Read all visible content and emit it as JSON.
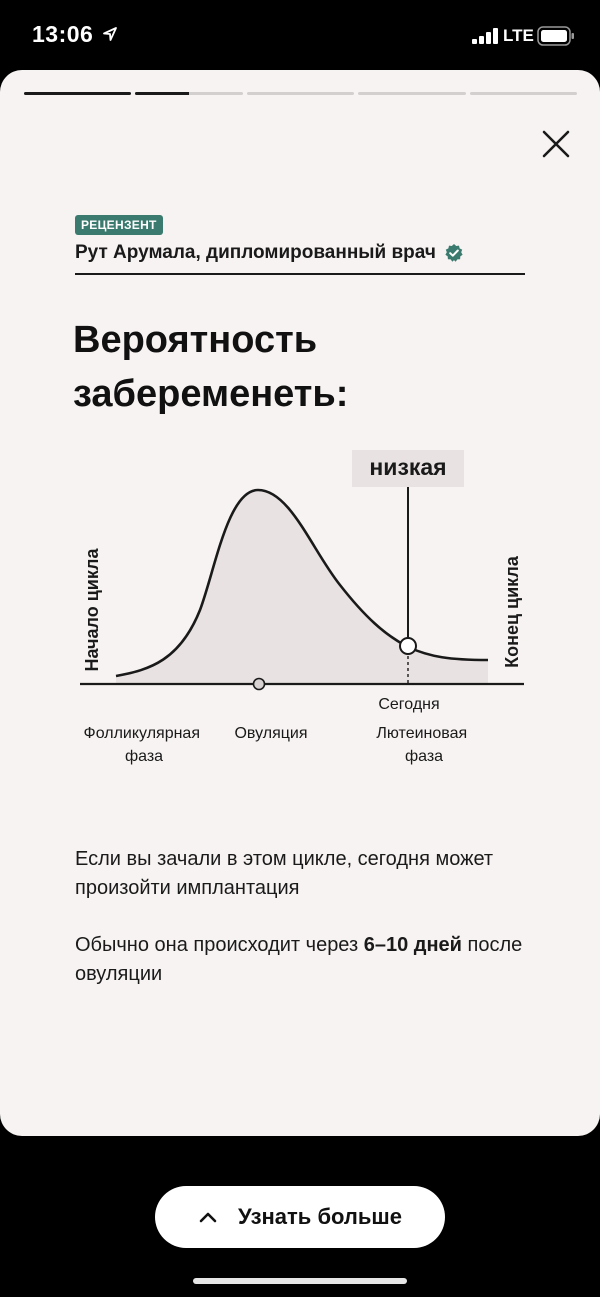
{
  "status_bar": {
    "time": "13:06",
    "network": "LTE",
    "icons": [
      "location-arrow-icon",
      "signal-icon",
      "battery-icon"
    ]
  },
  "progress": {
    "segments": 5,
    "fill": [
      1.0,
      0.5,
      0,
      0,
      0
    ]
  },
  "reviewer": {
    "badge": "РЕЦЕНЗЕНТ",
    "name": "Рут Арумала, дипломированный врач",
    "badge_color": "#3b7a6e"
  },
  "title": "Вероятность забеременеть:",
  "chart_data": {
    "type": "area",
    "title": "Вероятность забеременеть:",
    "y_axis_label_left": "Начало цикла",
    "y_axis_label_right": "Конец цикла",
    "marker_label": "низкая",
    "marker_point_label": "Сегодня",
    "x_labels": [
      "Фолликулярная фаза",
      "Овуляция",
      "Лютеиновая фаза"
    ],
    "fill_color": "#e8e3e2",
    "line_color": "#1a1a1a"
  },
  "info": {
    "paragraph_1": "Если вы зачали в этом цикле, сегодня может произойти имплантация",
    "paragraph_2_prefix": "Обычно она происходит через ",
    "paragraph_2_bold": "6–10 дней",
    "paragraph_2_suffix": " после овуляции"
  },
  "button": {
    "label": "Узнать больше"
  }
}
